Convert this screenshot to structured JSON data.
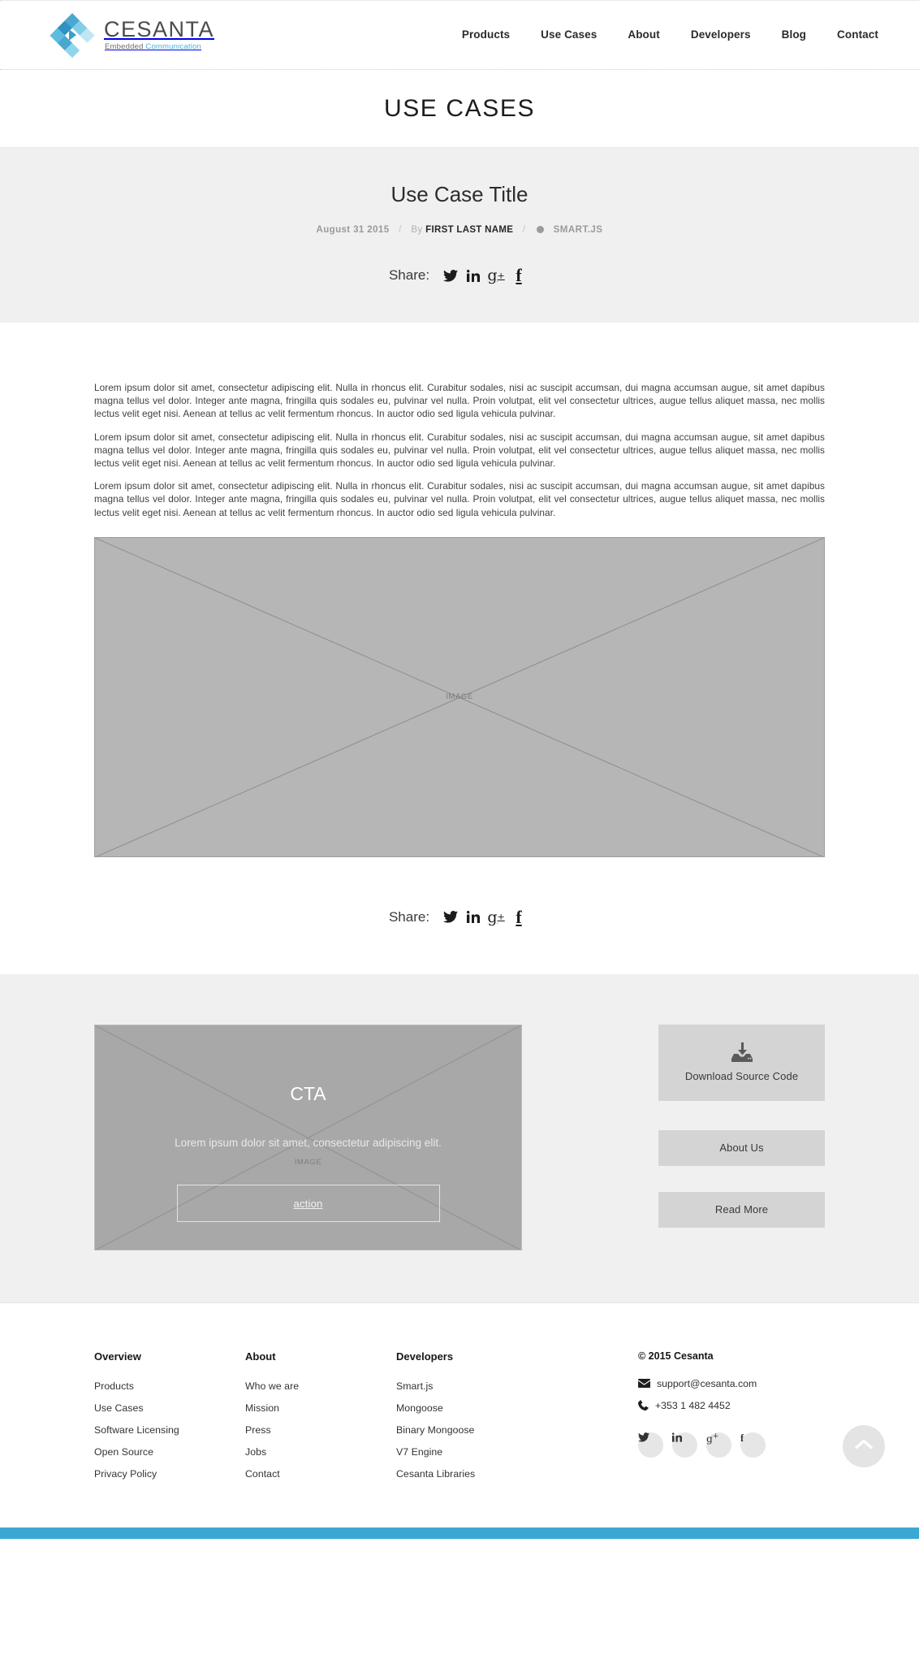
{
  "brand": {
    "name": "CESANTA",
    "tagline_1": "Embedded ",
    "tagline_2": "Communication",
    "accent": "#49b0dd"
  },
  "nav": {
    "items": [
      {
        "label": "Products"
      },
      {
        "label": "Use Cases"
      },
      {
        "label": "About"
      },
      {
        "label": "Developers"
      },
      {
        "label": "Blog"
      },
      {
        "label": "Contact"
      }
    ]
  },
  "page": {
    "title": "USE CASES"
  },
  "hero": {
    "title": "Use Case Title",
    "meta": {
      "date": "August 31 2015",
      "separator": "/",
      "by_label": "By",
      "author": "FIRST LAST NAME",
      "category": "SMART.JS"
    },
    "share": {
      "label": "Share:",
      "icons": [
        {
          "name": "twitter-icon",
          "glyph": "twitter"
        },
        {
          "name": "linkedin-icon",
          "glyph": "in"
        },
        {
          "name": "googleplus-icon",
          "glyph": "g+"
        },
        {
          "name": "facebook-icon",
          "glyph": "f"
        }
      ]
    }
  },
  "article": {
    "paragraphs": [
      "Lorem ipsum dolor sit amet, consectetur adipiscing elit. Nulla in rhoncus elit. Curabitur sodales, nisi ac suscipit accumsan, dui magna accumsan augue, sit amet dapibus magna tellus vel dolor. Integer ante magna, fringilla quis sodales eu, pulvinar vel nulla. Proin volutpat, elit vel consectetur ultrices, augue tellus aliquet massa, nec mollis lectus velit eget nisi. Aenean at tellus ac velit fermentum rhoncus. In auctor odio sed ligula vehicula pulvinar.",
      "Lorem ipsum dolor sit amet, consectetur adipiscing elit. Nulla in rhoncus elit. Curabitur sodales, nisi ac suscipit accumsan, dui magna accumsan augue, sit amet dapibus magna tellus vel dolor. Integer ante magna, fringilla quis sodales eu, pulvinar vel nulla. Proin volutpat, elit vel consectetur ultrices, augue tellus aliquet massa, nec mollis lectus velit eget nisi. Aenean at tellus ac velit fermentum rhoncus. In auctor odio sed ligula vehicula pulvinar.",
      "Lorem ipsum dolor sit amet, consectetur adipiscing elit. Nulla in rhoncus elit. Curabitur sodales, nisi ac suscipit accumsan, dui magna accumsan augue, sit amet dapibus magna tellus vel dolor. Integer ante magna, fringilla quis sodales eu, pulvinar vel nulla. Proin volutpat, elit vel consectetur ultrices, augue tellus aliquet massa, nec mollis lectus velit eget nisi. Aenean at tellus ac velit fermentum rhoncus. In auctor odio sed ligula vehicula pulvinar."
    ],
    "image_placeholder_label": "IMAGE",
    "share_label": "Share:"
  },
  "cta": {
    "title": "CTA",
    "subtitle": "Lorem ipsum dolor sit amet, consectetur adipiscing elit.",
    "image_placeholder_label": "IMAGE",
    "button_label": "action"
  },
  "sidebar": {
    "buttons": [
      {
        "name": "download-source-code-button",
        "label": "Download Source Code",
        "icon": "download-icon"
      },
      {
        "name": "about-us-button",
        "label": "About Us"
      },
      {
        "name": "read-more-button",
        "label": "Read More"
      }
    ]
  },
  "footer": {
    "columns": [
      {
        "heading": "Overview",
        "links": [
          "Products",
          "Use Cases",
          "Software Licensing",
          "Open Source",
          "Privacy Policy"
        ]
      },
      {
        "heading": "About",
        "links": [
          "Who we are",
          "Mission",
          "Press",
          "Jobs",
          "Contact"
        ]
      },
      {
        "heading": "Developers",
        "links": [
          "Smart.js",
          "Mongoose",
          "Binary Mongoose",
          "V7 Engine",
          "Cesanta Libraries"
        ]
      }
    ],
    "contact": {
      "copyright": "© 2015 Cesanta",
      "email": "support@cesanta.com",
      "phone": "+353 1 482 4452"
    },
    "social": [
      {
        "name": "twitter-icon",
        "glyph": "twitter"
      },
      {
        "name": "linkedin-icon",
        "glyph": "in"
      },
      {
        "name": "googleplus-icon",
        "glyph": "g+"
      },
      {
        "name": "facebook-icon",
        "glyph": "f"
      }
    ],
    "scroll_top_icon": "chevron-up-icon",
    "bottom_bar_color": "#3ba8d4"
  }
}
